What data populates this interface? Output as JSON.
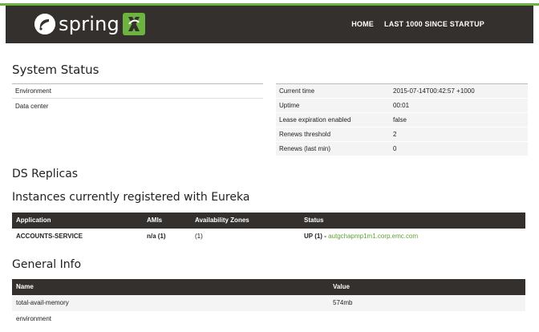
{
  "brand": {
    "name": "spring",
    "accent": "#6db33f",
    "nav_bg": "#34302d"
  },
  "nav": {
    "home": "HOME",
    "last1000": "LAST 1000 SINCE STARTUP"
  },
  "system_status": {
    "title": "System Status",
    "left": [
      {
        "label": "Environment"
      },
      {
        "label": "Data center"
      }
    ],
    "right": [
      {
        "label": "Current time",
        "value": "2015-07-14T00:42:57 +1000"
      },
      {
        "label": "Uptime",
        "value": "00:01"
      },
      {
        "label": "Lease expiration enabled",
        "value": "false"
      },
      {
        "label": "Renews threshold",
        "value": "2"
      },
      {
        "label": "Renews (last min)",
        "value": "0"
      }
    ]
  },
  "ds_replicas": {
    "title": "DS Replicas"
  },
  "instances": {
    "title": "Instances currently registered with Eureka",
    "columns": [
      "Application",
      "AMIs",
      "Availability Zones",
      "Status"
    ],
    "rows": [
      {
        "application": "ACCOUNTS-SERVICE",
        "amis": "n/a (1)",
        "zones": "(1)",
        "status_prefix": "UP (1) - ",
        "status_link": "autgchapmp1m1.corp.emc.com"
      }
    ]
  },
  "general_info": {
    "title": "General Info",
    "columns": [
      "Name",
      "Value"
    ],
    "rows": [
      {
        "name": "total-avail-memory",
        "value": "574mb"
      },
      {
        "name": "environment",
        "value": ""
      }
    ]
  }
}
